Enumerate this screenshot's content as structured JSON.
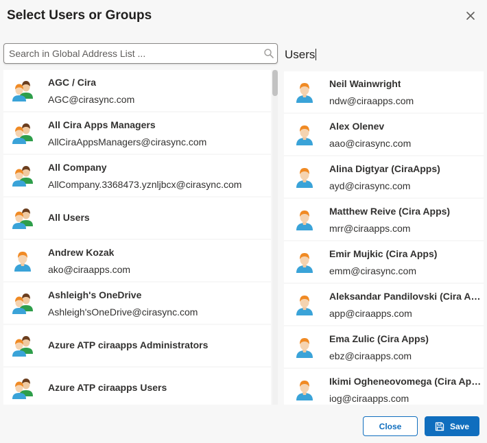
{
  "dialog": {
    "title": "Select Users or Groups",
    "close_icon": "close-icon"
  },
  "search": {
    "placeholder": "Search in Global Address List ...",
    "value": "",
    "icon": "search-icon"
  },
  "users_panel": {
    "heading": "Users"
  },
  "directory": [
    {
      "name": "AGC / Cira",
      "email": "AGC@cirasync.com",
      "kind": "group"
    },
    {
      "name": "All Cira Apps Managers",
      "email": "AllCiraAppsManagers@cirasync.com",
      "kind": "group"
    },
    {
      "name": "All Company",
      "email": "AllCompany.3368473.yznljbcx@cirasync.com",
      "kind": "group"
    },
    {
      "name": "All Users",
      "email": "",
      "kind": "group"
    },
    {
      "name": "Andrew Kozak",
      "email": "ako@ciraapps.com",
      "kind": "user"
    },
    {
      "name": "Ashleigh's OneDrive",
      "email": "Ashleigh'sOneDrive@cirasync.com",
      "kind": "group"
    },
    {
      "name": "Azure ATP ciraapps Administrators",
      "email": "",
      "kind": "group"
    },
    {
      "name": "Azure ATP ciraapps Users",
      "email": "",
      "kind": "group"
    }
  ],
  "selected_users": [
    {
      "name": "Neil Wainwright",
      "email": "ndw@ciraapps.com"
    },
    {
      "name": "Alex Olenev",
      "email": "aao@cirasync.com"
    },
    {
      "name": "Alina Digtyar (CiraApps)",
      "email": "ayd@cirasync.com"
    },
    {
      "name": "Matthew Reive (Cira Apps)",
      "email": "mrr@ciraapps.com"
    },
    {
      "name": "Emir Mujkic (Cira Apps)",
      "email": "emm@cirasync.com"
    },
    {
      "name": "Aleksandar Pandilovski (Cira Apps)",
      "email": "app@ciraapps.com"
    },
    {
      "name": "Ema Zulic (Cira Apps)",
      "email": "ebz@ciraapps.com"
    },
    {
      "name": "Ikimi Ogheneovomega (Cira Apps)",
      "email": "iog@ciraapps.com"
    }
  ],
  "footer": {
    "close_label": "Close",
    "save_label": "Save",
    "save_icon": "save-icon"
  },
  "colors": {
    "accent": "#106ebe",
    "background": "#f7f7f7",
    "user_avatar_hair": "#f08a24",
    "user_avatar_shirt": "#3aa3d8",
    "group_avatar_back_hair": "#6b3e1e",
    "group_avatar_back_shirt": "#2e9e4a"
  }
}
